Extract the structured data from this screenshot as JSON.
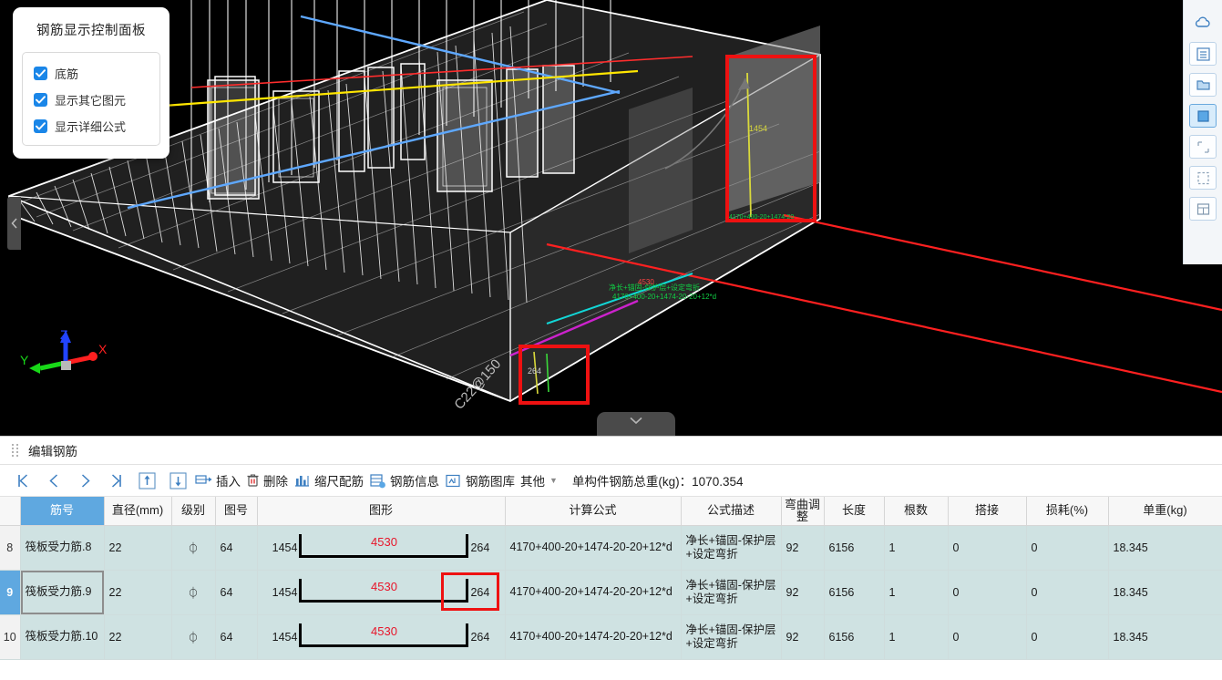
{
  "control_panel": {
    "title": "钢筋显示控制面板",
    "checkboxes": [
      {
        "label": "底筋",
        "checked": true
      },
      {
        "label": "显示其它图元",
        "checked": true
      },
      {
        "label": "显示详细公式",
        "checked": true
      }
    ]
  },
  "viewport": {
    "axis": {
      "x": "X",
      "y": "Y",
      "z": "Z"
    },
    "dim_label_top": "1454",
    "dim_label_bottom": "264",
    "rebar_label": "C22@150",
    "annotation_line1": "净长+锚固-保护层+设定弯折",
    "annotation_line2": "4170+400-20+1474-20-20+12*d",
    "small_label_1": "4530",
    "collapse_left_icon": "chevron-left-icon",
    "collapse_bottom_icon": "chevron-down-icon"
  },
  "right_rail": {
    "items": [
      {
        "icon": "cloud-icon",
        "active": false
      },
      {
        "icon": "list-icon",
        "active": false
      },
      {
        "icon": "folder-icon",
        "active": false
      },
      {
        "icon": "highlight-icon",
        "active": true
      },
      {
        "icon": "crop-icon",
        "active": false
      },
      {
        "icon": "dashed-box-icon",
        "active": false
      },
      {
        "icon": "table-icon",
        "active": false
      }
    ]
  },
  "panel": {
    "header_title": "编辑钢筋",
    "drag_handle_icon": "drag-dots-icon"
  },
  "toolbar": {
    "nav": [
      {
        "icon": "first-record-icon",
        "name": "first"
      },
      {
        "icon": "prev-record-icon",
        "name": "prev"
      },
      {
        "icon": "next-record-icon",
        "name": "next"
      },
      {
        "icon": "last-record-icon",
        "name": "last"
      },
      {
        "icon": "move-up-icon",
        "name": "up"
      },
      {
        "icon": "move-down-icon",
        "name": "down"
      }
    ],
    "buttons": [
      {
        "label": "插入",
        "icon": "insert-row-icon"
      },
      {
        "label": "删除",
        "icon": "trash-icon"
      },
      {
        "label": "缩尺配筋",
        "icon": "scale-rebar-icon"
      },
      {
        "label": "钢筋信息",
        "icon": "rebar-info-icon"
      },
      {
        "label": "钢筋图库",
        "icon": "rebar-library-icon"
      },
      {
        "label": "其他",
        "icon": "chevron-down-icon",
        "has_caret": true
      }
    ],
    "total_label": "单构件钢筋总重(kg)：1070.354"
  },
  "table": {
    "columns": [
      {
        "key": "no",
        "label": ""
      },
      {
        "key": "name",
        "label": "筋号",
        "selected": true
      },
      {
        "key": "dia",
        "label": "直径(mm)"
      },
      {
        "key": "lvl",
        "label": "级别"
      },
      {
        "key": "pic",
        "label": "图号"
      },
      {
        "key": "shape",
        "label": "图形"
      },
      {
        "key": "formula",
        "label": "计算公式"
      },
      {
        "key": "desc",
        "label": "公式描述"
      },
      {
        "key": "bend",
        "label": "弯曲调整"
      },
      {
        "key": "len",
        "label": "长度"
      },
      {
        "key": "cnt",
        "label": "根数"
      },
      {
        "key": "lap",
        "label": "搭接"
      },
      {
        "key": "loss",
        "label": "损耗(%)"
      },
      {
        "key": "unitw",
        "label": "单重(kg)"
      }
    ],
    "rows": [
      {
        "no": "8",
        "name": "筏板受力筋.8",
        "dia": "22",
        "lvl": "⏀",
        "pic": "64",
        "shape": {
          "left": "1454",
          "mid": "4530",
          "right": "264"
        },
        "formula": "4170+400-20+1474-20-20+12*d",
        "desc": "净长+锚固-保护层+设定弯折",
        "bend": "92",
        "len": "6156",
        "cnt": "1",
        "lap": "0",
        "loss": "0",
        "unitw": "18.345",
        "selected": false,
        "highlight_shape": false
      },
      {
        "no": "9",
        "name": "筏板受力筋.9",
        "dia": "22",
        "lvl": "⏀",
        "pic": "64",
        "shape": {
          "left": "1454",
          "mid": "4530",
          "right": "264"
        },
        "formula": "4170+400-20+1474-20-20+12*d",
        "desc": "净长+锚固-保护层+设定弯折",
        "bend": "92",
        "len": "6156",
        "cnt": "1",
        "lap": "0",
        "loss": "0",
        "unitw": "18.345",
        "selected": true,
        "highlight_shape": true
      },
      {
        "no": "10",
        "name": "筏板受力筋.10",
        "dia": "22",
        "lvl": "⏀",
        "pic": "64",
        "shape": {
          "left": "1454",
          "mid": "4530",
          "right": "264"
        },
        "formula": "4170+400-20+1474-20-20+12*d",
        "desc": "净长+锚固-保护层+设定弯折",
        "bend": "92",
        "len": "6156",
        "cnt": "1",
        "lap": "0",
        "loss": "0",
        "unitw": "18.345",
        "selected": false,
        "highlight_shape": false
      }
    ]
  },
  "colors": {
    "accent": "#5fa8e0",
    "cell_bg": "#cfe2e2",
    "highlight_red": "#ee1111",
    "shape_red": "#e8152a",
    "checkbox_blue": "#1a86e8"
  }
}
